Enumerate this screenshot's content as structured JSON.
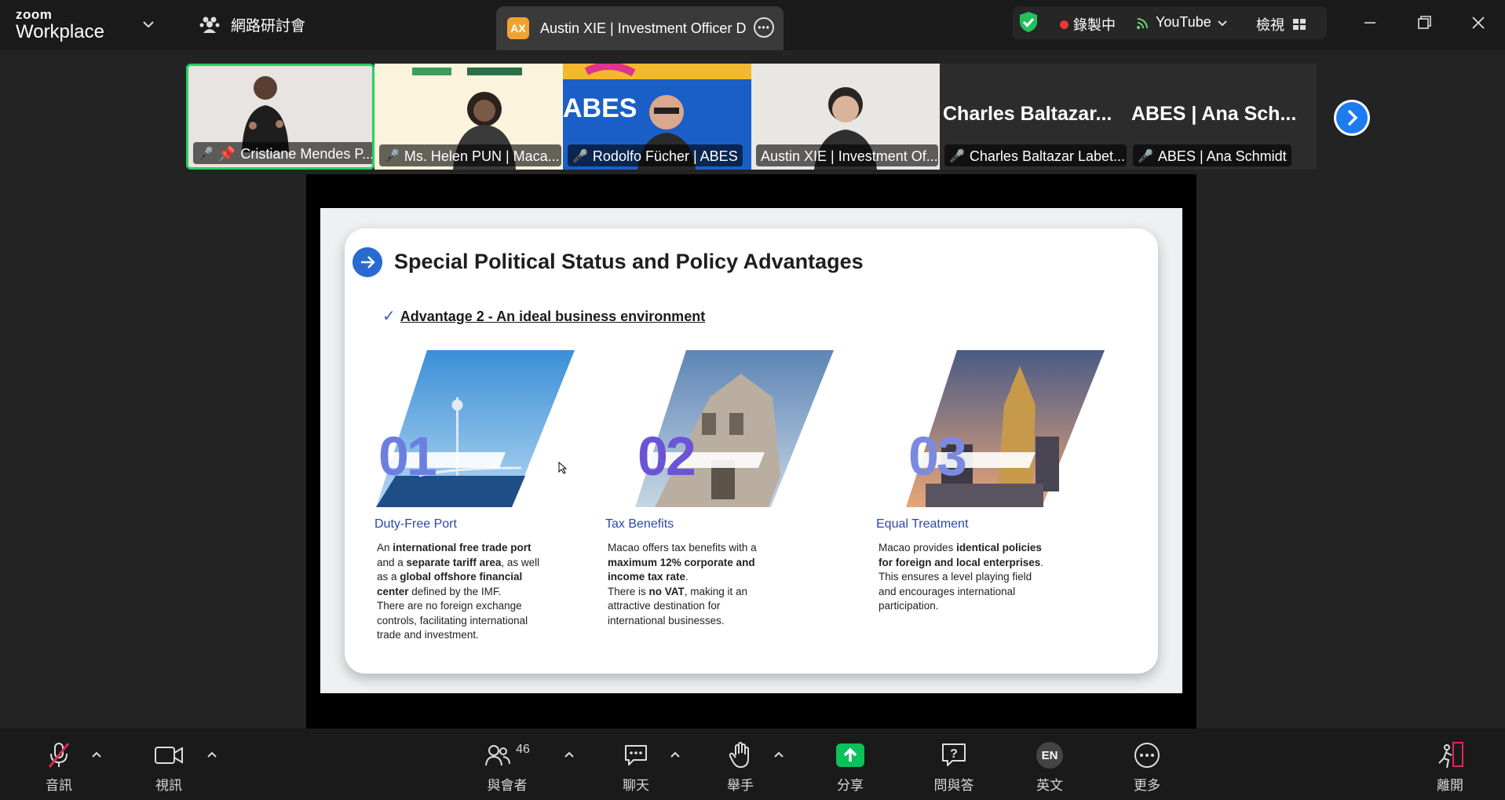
{
  "app": {
    "brand_small": "zoom",
    "brand_large": "Workplace",
    "webinar_label": "網路研討會"
  },
  "tab": {
    "initials": "AX",
    "title": "Austin XIE | Investment Officer  D"
  },
  "status": {
    "recording": "錄製中",
    "stream": "YouTube",
    "view": "檢視"
  },
  "gallery": [
    {
      "name": "Cristiane Mendes P...",
      "muted": true,
      "pinned": true,
      "active": true
    },
    {
      "name": "Ms. Helen PUN | Maca...",
      "muted": true
    },
    {
      "name": "Rodolfo Fücher | ABES",
      "muted": true
    },
    {
      "name": "Austin XIE | Investment Of...",
      "muted": false
    },
    {
      "name": "Charles Baltazar Labet...",
      "muted": true,
      "big": "Charles  Baltazar..."
    },
    {
      "name": "ABES | Ana Schmidt",
      "muted": true,
      "big": "ABES | Ana Sch..."
    }
  ],
  "slide": {
    "title": "Special Political Status and Policy Advantages",
    "check": "✓",
    "advantage": "Advantage 2 - An ideal business environment",
    "items": [
      {
        "num": "01",
        "heading": "Duty-Free Port"
      },
      {
        "num": "02",
        "heading": "Tax Benefits"
      },
      {
        "num": "03",
        "heading": "Equal Treatment"
      }
    ],
    "p1": {
      "a": "An ",
      "b": "international free trade port",
      "c": " and a ",
      "d": "separate tariff area",
      "e": ", as well as a ",
      "f": "global offshore financial center",
      "g": " defined by the IMF.",
      "h": "There are no foreign exchange controls, facilitating international trade and investment."
    },
    "p2": {
      "a": "Macao offers tax benefits with a ",
      "b": "maximum 12% corporate and income tax rate",
      "c": ".",
      "d": "There is ",
      "e": "no VAT",
      "f": ", making it an attractive destination for international businesses."
    },
    "p3": {
      "a": "Macao provides ",
      "b": "identical policies for foreign and local enterprises",
      "c": ".",
      "d": "This ensures a level playing field and encourages international participation."
    }
  },
  "toolbar": {
    "audio": "音訊",
    "video": "視訊",
    "participants": "與會者",
    "participant_count": "46",
    "chat": "聊天",
    "raise_hand": "舉手",
    "share": "分享",
    "qa": "問與答",
    "lang_badge": "EN",
    "lang": "英文",
    "more": "更多",
    "leave": "離開"
  },
  "colors": {
    "accent": "#2d8cff",
    "active_border": "#23d160",
    "share_green": "#0bc15a",
    "slide_blue": "#2c46a8"
  }
}
